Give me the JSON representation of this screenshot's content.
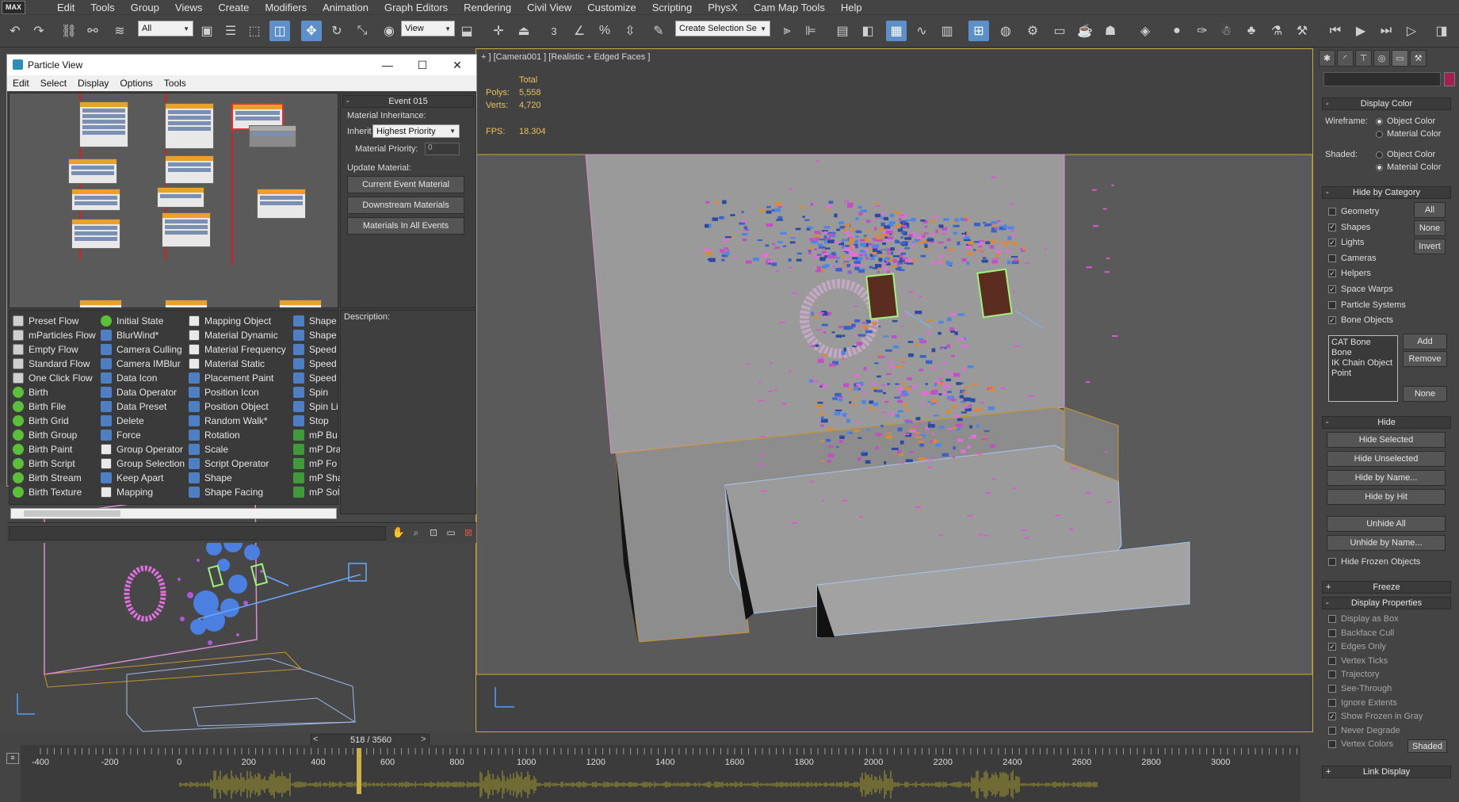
{
  "menubar": {
    "logo": "MAX",
    "items": [
      "Edit",
      "Tools",
      "Group",
      "Views",
      "Create",
      "Modifiers",
      "Animation",
      "Graph Editors",
      "Rendering",
      "Civil View",
      "Customize",
      "Scripting",
      "PhysX",
      "Cam Map Tools",
      "Help"
    ]
  },
  "toolbar": {
    "selection_filter": "All",
    "ref_coord": "View",
    "snap_label": "3",
    "named_selection": "Create Selection Se",
    "icons": [
      "undo-icon",
      "redo-icon",
      "link-icon",
      "unlink-icon",
      "bind-spacewarp-icon",
      "select-icon",
      "select-by-name-icon",
      "rect-region-icon",
      "window-crossing-icon",
      "move-icon",
      "rotate-icon",
      "scale-icon",
      "pivot-icon",
      "select-manipulate-icon",
      "keyboard-shortcut-icon",
      "snap-icon",
      "angle-snap-icon",
      "percent-snap-icon",
      "spinner-snap-icon",
      "edit-named-selection-icon",
      "mirror-icon",
      "align-icon",
      "layer-explorer-icon",
      "scene-explorer-icon",
      "ribbon-icon",
      "curve-editor-icon",
      "schematic-view-icon",
      "material-editor-icon",
      "render-setup-icon",
      "rendered-frame-icon",
      "render-icon"
    ]
  },
  "particle_view": {
    "title": "Particle View",
    "menu": [
      "Edit",
      "Select",
      "Display",
      "Options",
      "Tools"
    ],
    "event_title": "Event 015",
    "material_inheritance": "Material Inheritance:",
    "inherit_label": "Inherit",
    "inherit_value": "Highest Priority",
    "priority_label": "Material Priority:",
    "priority_value": "0",
    "update_material": "Update Material:",
    "buttons": [
      "Current Event Material",
      "Downstream Materials",
      "Materials In All Events"
    ],
    "description_label": "Description:",
    "depot_col1": [
      {
        "label": "Preset Flow",
        "icon": "flow"
      },
      {
        "label": "mParticles Flow",
        "icon": "flow"
      },
      {
        "label": "Empty Flow",
        "icon": "flow"
      },
      {
        "label": "Standard Flow",
        "icon": "flow"
      },
      {
        "label": "One Click Flow",
        "icon": "flow"
      },
      {
        "label": "Birth",
        "icon": "birth"
      },
      {
        "label": "Birth File",
        "icon": "birth"
      },
      {
        "label": "Birth Grid",
        "icon": "birth"
      },
      {
        "label": "Birth Group",
        "icon": "birth"
      },
      {
        "label": "Birth Paint",
        "icon": "birth"
      },
      {
        "label": "Birth Script",
        "icon": "birth"
      },
      {
        "label": "Birth Stream",
        "icon": "birth"
      },
      {
        "label": "Birth Texture",
        "icon": "birth"
      }
    ],
    "depot_col2": [
      {
        "label": "Initial State",
        "icon": "birth"
      },
      {
        "label": "BlurWind*",
        "icon": "op"
      },
      {
        "label": "Camera Culling",
        "icon": "op"
      },
      {
        "label": "Camera IMBlur",
        "icon": "op"
      },
      {
        "label": "Data Icon",
        "icon": "op"
      },
      {
        "label": "Data Operator",
        "icon": "op"
      },
      {
        "label": "Data Preset",
        "icon": "op"
      },
      {
        "label": "Delete",
        "icon": "op"
      },
      {
        "label": "Force",
        "icon": "op"
      },
      {
        "label": "Group Operator",
        "icon": "mat"
      },
      {
        "label": "Group Selection",
        "icon": "mat"
      },
      {
        "label": "Keep Apart",
        "icon": "op"
      },
      {
        "label": "Mapping",
        "icon": "mat"
      }
    ],
    "depot_col3": [
      {
        "label": "Mapping Object",
        "icon": "mat"
      },
      {
        "label": "Material Dynamic",
        "icon": "mat"
      },
      {
        "label": "Material Frequency",
        "icon": "mat"
      },
      {
        "label": "Material Static",
        "icon": "mat"
      },
      {
        "label": "Placement Paint",
        "icon": "op"
      },
      {
        "label": "Position Icon",
        "icon": "op"
      },
      {
        "label": "Position Object",
        "icon": "op"
      },
      {
        "label": "Random Walk*",
        "icon": "op"
      },
      {
        "label": "Rotation",
        "icon": "op"
      },
      {
        "label": "Scale",
        "icon": "op"
      },
      {
        "label": "Script Operator",
        "icon": "op"
      },
      {
        "label": "Shape",
        "icon": "op"
      },
      {
        "label": "Shape Facing",
        "icon": "op"
      }
    ],
    "depot_col4": [
      {
        "label": "Shape",
        "icon": "op"
      },
      {
        "label": "Shape",
        "icon": "op"
      },
      {
        "label": "Speed",
        "icon": "op"
      },
      {
        "label": "Speed",
        "icon": "op"
      },
      {
        "label": "Speed",
        "icon": "op"
      },
      {
        "label": "Spin",
        "icon": "op"
      },
      {
        "label": "Spin Li",
        "icon": "op"
      },
      {
        "label": "Stop",
        "icon": "op"
      },
      {
        "label": "mP Bu",
        "icon": "mp"
      },
      {
        "label": "mP Dra",
        "icon": "mp"
      },
      {
        "label": "mP Fo",
        "icon": "mp"
      },
      {
        "label": "mP Sha",
        "icon": "mp"
      },
      {
        "label": "mP Sol",
        "icon": "mp"
      }
    ]
  },
  "viewport": {
    "label": "+ ] [Camera001 ] [Realistic + Edged Faces ]",
    "total_label": "Total",
    "polys_label": "Polys:",
    "polys": "5,558",
    "verts_label": "Verts:",
    "verts": "4,720",
    "fps_label": "FPS:",
    "fps": "18.304"
  },
  "command_panel": {
    "display_color": {
      "title": "Display Color",
      "wireframe": "Wireframe:",
      "shaded": "Shaded:",
      "object_color": "Object Color",
      "material_color": "Material Color"
    },
    "hide_by_category": {
      "title": "Hide by Category",
      "items": [
        {
          "label": "Geometry",
          "checked": false
        },
        {
          "label": "Shapes",
          "checked": true
        },
        {
          "label": "Lights",
          "checked": true
        },
        {
          "label": "Cameras",
          "checked": false
        },
        {
          "label": "Helpers",
          "checked": true
        },
        {
          "label": "Space Warps",
          "checked": true
        },
        {
          "label": "Particle Systems",
          "checked": false
        },
        {
          "label": "Bone Objects",
          "checked": true
        }
      ],
      "btn_all": "All",
      "btn_none": "None",
      "btn_invert": "Invert",
      "list": [
        "CAT Bone",
        "Bone",
        "IK Chain Object",
        "Point"
      ],
      "btn_add": "Add",
      "btn_remove": "Remove",
      "btn_none2": "None"
    },
    "hide": {
      "title": "Hide",
      "buttons": [
        "Hide Selected",
        "Hide Unselected",
        "Hide by Name...",
        "Hide by Hit",
        "Unhide All",
        "Unhide by Name..."
      ],
      "hide_frozen": "Hide Frozen Objects"
    },
    "freeze": {
      "title": "Freeze"
    },
    "display_properties": {
      "title": "Display Properties",
      "items": [
        {
          "label": "Display as Box",
          "checked": false
        },
        {
          "label": "Backface Cull",
          "checked": false
        },
        {
          "label": "Edges Only",
          "checked": true
        },
        {
          "label": "Vertex Ticks",
          "checked": false
        },
        {
          "label": "Trajectory",
          "checked": false
        },
        {
          "label": "See-Through",
          "checked": false
        },
        {
          "label": "Ignore Extents",
          "checked": false
        },
        {
          "label": "Show Frozen in Gray",
          "checked": true
        },
        {
          "label": "Never Degrade",
          "checked": false
        },
        {
          "label": "Vertex Colors",
          "checked": false
        }
      ],
      "shaded_btn": "Shaded"
    },
    "link_display": {
      "title": "Link Display"
    }
  },
  "timeline": {
    "slider_text": "518 / 3560",
    "ticks": [
      "-400",
      "-200",
      "0",
      "200",
      "400",
      "600",
      "800",
      "1000",
      "1200",
      "1400",
      "1600",
      "1800",
      "2000",
      "2200",
      "2400",
      "2600",
      "2800",
      "3000"
    ]
  },
  "colors": {
    "accent": "#5d8fc9",
    "viewport_border": "#c9a93a",
    "stats": "#e6c35c",
    "wave": "#a59a2c"
  }
}
